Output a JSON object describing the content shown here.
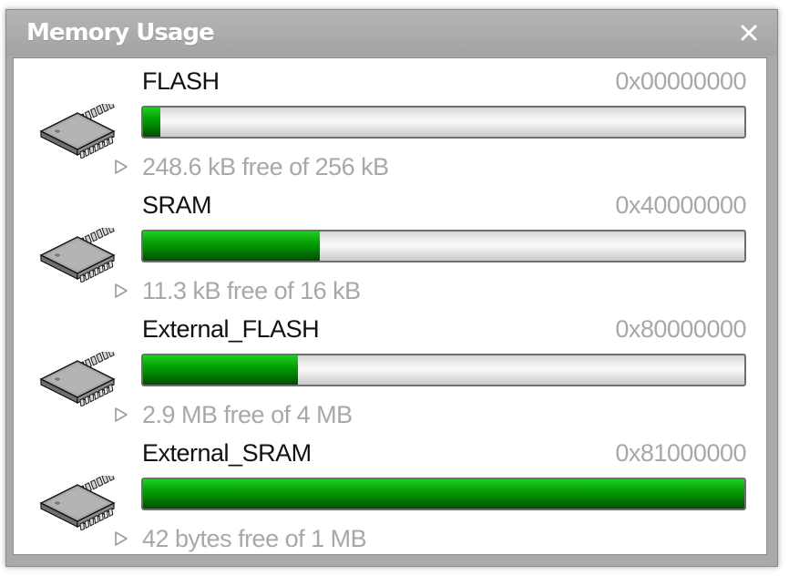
{
  "window": {
    "title": "Memory Usage",
    "close_icon": "close-icon"
  },
  "colors": {
    "fill": "#009400",
    "muted_text": "#a8a8a8",
    "title_bar": "#a9a9a9"
  },
  "memories": [
    {
      "name": "FLASH",
      "address": "0x00000000",
      "used_fraction": 0.029,
      "free_text": "248.6 kB free of 256 kB",
      "icon": "chip-icon"
    },
    {
      "name": "SRAM",
      "address": "0x40000000",
      "used_fraction": 0.294,
      "free_text": "11.3 kB free of 16 kB",
      "icon": "chip-icon"
    },
    {
      "name": "External_FLASH",
      "address": "0x80000000",
      "used_fraction": 0.257,
      "free_text": "2.9 MB free of 4 MB",
      "icon": "chip-icon"
    },
    {
      "name": "External_SRAM",
      "address": "0x81000000",
      "used_fraction": 1.0,
      "free_text": "42 bytes free of 1 MB",
      "icon": "chip-icon"
    }
  ]
}
